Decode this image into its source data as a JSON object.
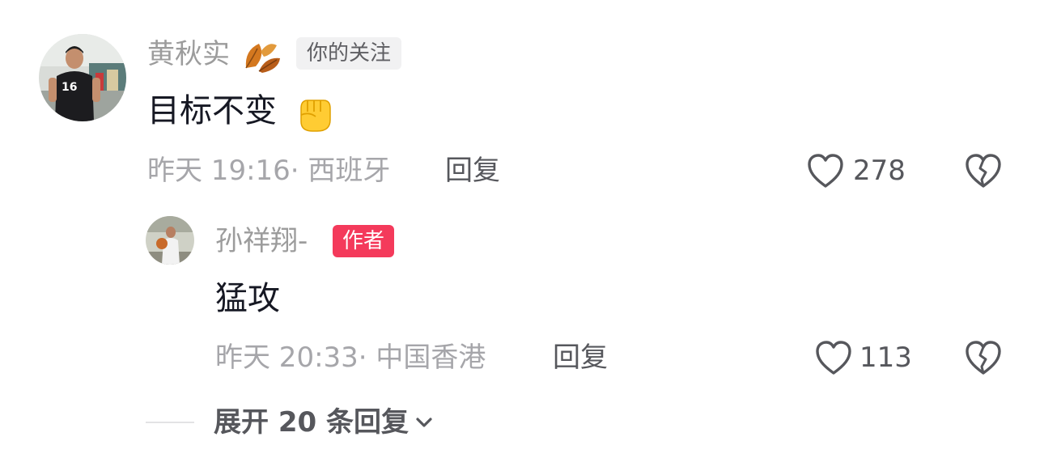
{
  "comment": {
    "username": "黄秋实",
    "badge": "你的关注",
    "text": "目标不变",
    "time": "昨天 19:16",
    "location": "西班牙",
    "reply_label": "回复",
    "likes": "278",
    "avatar_jersey_number": "16"
  },
  "reply": {
    "username": "孙祥翔-",
    "badge": "作者",
    "text": "猛攻",
    "time": "昨天 20:33",
    "location": "中国香港",
    "reply_label": "回复",
    "likes": "113"
  },
  "expand_label": "展开 20 条回复",
  "colors": {
    "author_badge": "#f43a5b",
    "follow_badge_bg": "#f1f1f2",
    "muted_text": "#a6a6aa",
    "primary_text": "#161823"
  },
  "icons": {
    "username_decoration": "autumn-leaf-icon",
    "comment_emoji": "raised-fist-emoji",
    "like": "heart-outline-icon",
    "dislike": "broken-heart-outline-icon",
    "expand": "chevron-down-icon"
  }
}
